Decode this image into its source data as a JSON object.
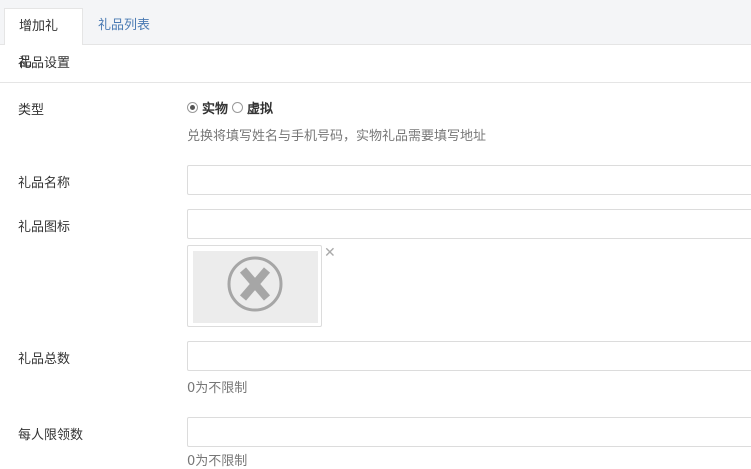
{
  "tabs": [
    {
      "label": "增加礼品"
    },
    {
      "label": "礼品列表"
    }
  ],
  "panel": {
    "title": "礼品设置"
  },
  "form": {
    "type": {
      "label": "类型",
      "options": [
        {
          "label": "实物",
          "checked": true
        },
        {
          "label": "虚拟",
          "checked": false
        }
      ],
      "help": "兑换将填写姓名与手机号码，实物礼品需要填写地址"
    },
    "name": {
      "label": "礼品名称",
      "value": ""
    },
    "icon": {
      "label": "礼品图标",
      "value": ""
    },
    "total": {
      "label": "礼品总数",
      "value": "",
      "help": "0为不限制"
    },
    "per_user": {
      "label": "每人限领数",
      "value": "",
      "help": "0为不限制"
    }
  },
  "colors": {
    "tab_link": "#4a7ab3",
    "border": "#dcdcdc",
    "help_text": "#777777"
  },
  "icons": {
    "placeholder": "x-circle-icon",
    "remove": "close-icon"
  }
}
